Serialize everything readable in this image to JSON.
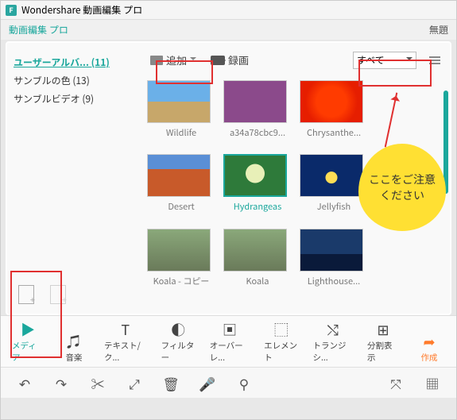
{
  "app": {
    "title": "Wondershare 動画編集 プロ",
    "subtitle": "動画編集 プロ",
    "untitled": "無題"
  },
  "sidebar": {
    "items": [
      {
        "label": "ユーザーアルバ... (11)",
        "active": true
      },
      {
        "label": "サンブルの色 (13)",
        "active": false
      },
      {
        "label": "サンブルビデオ (9)",
        "active": false
      }
    ]
  },
  "topbar": {
    "add": "追加",
    "record": "録画",
    "filter": "すべて"
  },
  "thumbs": [
    {
      "cap": "Wildlife",
      "cls": "wildlife",
      "sel": false
    },
    {
      "cap": "a34a78cbc9...",
      "cls": "abstract",
      "sel": false
    },
    {
      "cap": "Chrysanthe...",
      "cls": "chrys",
      "sel": false
    },
    {
      "cap": "Desert",
      "cls": "desert",
      "sel": false
    },
    {
      "cap": "Hydrangeas",
      "cls": "hydra",
      "sel": true
    },
    {
      "cap": "Jellyfish",
      "cls": "jelly",
      "sel": false
    },
    {
      "cap": "Koala - コピー",
      "cls": "koala",
      "sel": false
    },
    {
      "cap": "Koala",
      "cls": "koala",
      "sel": false
    },
    {
      "cap": "Lighthouse...",
      "cls": "light",
      "sel": false
    }
  ],
  "callout": "ここをご注意ください",
  "tabs": [
    {
      "label": "メディア",
      "icon": "▶",
      "active": true
    },
    {
      "label": "音楽",
      "icon": "♫"
    },
    {
      "label": "テキスト/ク...",
      "icon": "T"
    },
    {
      "label": "フィルター",
      "icon": "◐"
    },
    {
      "label": "オーバーレ...",
      "icon": "▣"
    },
    {
      "label": "エレメント",
      "icon": "⬚"
    },
    {
      "label": "トランジシ...",
      "icon": "⤭"
    },
    {
      "label": "分割表示",
      "icon": "⊞"
    }
  ],
  "create": {
    "label": "作成",
    "icon": "➦"
  },
  "tools": [
    "↶",
    "↷",
    "✂",
    "⤢",
    "🗑",
    "🎤",
    "⚲",
    "⤧",
    "▦"
  ]
}
